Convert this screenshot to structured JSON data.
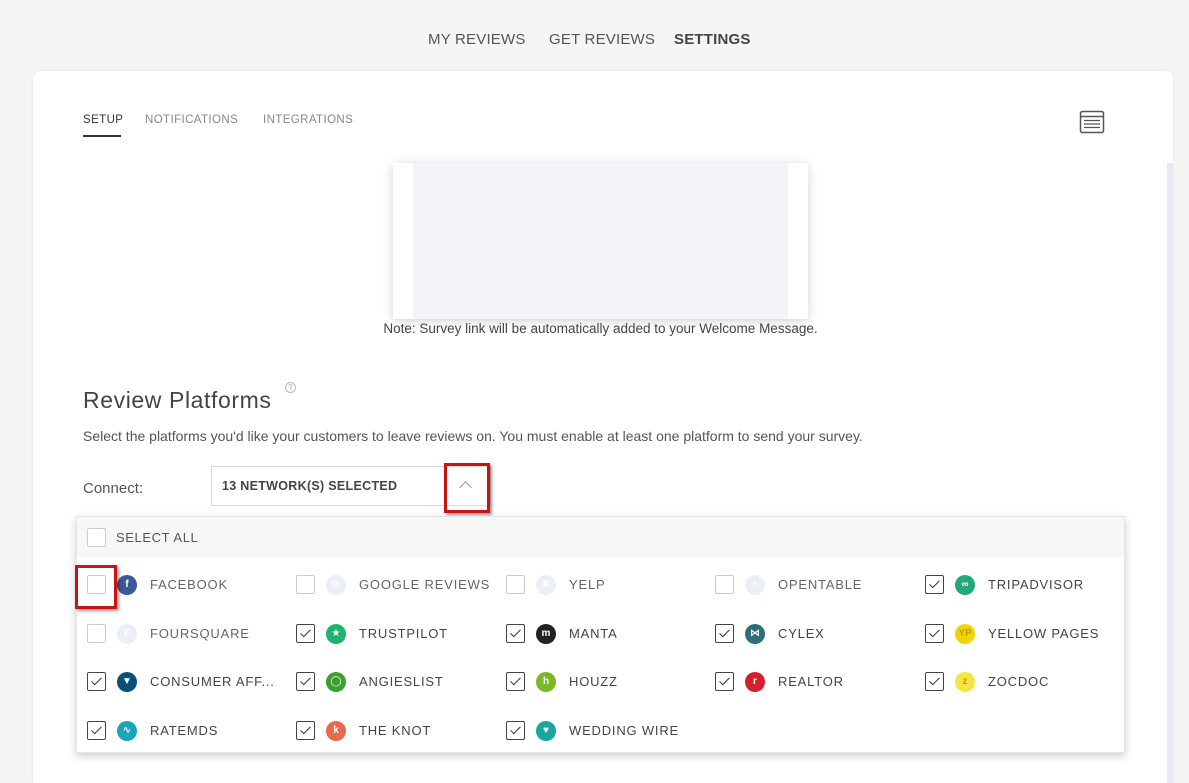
{
  "topnav": {
    "items": [
      {
        "label": "MY REVIEWS",
        "active": false
      },
      {
        "label": "GET REVIEWS",
        "active": false
      },
      {
        "label": "SETTINGS",
        "active": true
      }
    ]
  },
  "subtabs": [
    {
      "label": "SETUP",
      "active": true
    },
    {
      "label": "NOTIFICATIONS",
      "active": false
    },
    {
      "label": "INTEGRATIONS",
      "active": false
    }
  ],
  "preview": {
    "note": "Note: Survey link will be automatically added to your Welcome Message."
  },
  "review_platforms": {
    "title": "Review Platforms",
    "help": "?",
    "description": "Select the platforms you'd like your customers to leave reviews on. You must enable at least one platform to send your survey.",
    "connect_label": "Connect:",
    "selected_text": "13 NETWORK(S) SELECTED",
    "select_all_label": "SELECT ALL",
    "select_all_checked": false,
    "platforms": [
      {
        "label": "FACEBOOK",
        "checked": false,
        "icon": "facebook-icon",
        "glyph": "f",
        "color": "#3b5998"
      },
      {
        "label": "GOOGLE REVIEWS",
        "checked": false,
        "icon": "google-icon",
        "glyph": "G",
        "color": "#b8c4d6"
      },
      {
        "label": "YELP",
        "checked": false,
        "icon": "yelp-icon",
        "glyph": "✱",
        "color": "#b8c4d6"
      },
      {
        "label": "OPENTABLE",
        "checked": false,
        "icon": "opentable-icon",
        "glyph": "•",
        "color": "#b8c4d6"
      },
      {
        "label": "TRIPADVISOR",
        "checked": true,
        "icon": "tripadvisor-icon",
        "glyph": "∞",
        "color": "#22a87a"
      },
      {
        "label": "FOURSQUARE",
        "checked": false,
        "icon": "foursquare-icon",
        "glyph": "F",
        "color": "#b8c4d6"
      },
      {
        "label": "TRUSTPILOT",
        "checked": true,
        "icon": "trustpilot-icon",
        "glyph": "★",
        "color": "#1fb36b"
      },
      {
        "label": "MANTA",
        "checked": true,
        "icon": "manta-icon",
        "glyph": "m",
        "color": "#222222"
      },
      {
        "label": "CYLEX",
        "checked": true,
        "icon": "cylex-icon",
        "glyph": "⋈",
        "color": "#2d6e78"
      },
      {
        "label": "YELLOW PAGES",
        "checked": true,
        "icon": "yellowpages-icon",
        "glyph": "YP",
        "color": "#f0d400"
      },
      {
        "label": "CONSUMER AFF...",
        "checked": true,
        "icon": "consumeraffairs-icon",
        "glyph": "▼",
        "color": "#0b4f79"
      },
      {
        "label": "ANGIESLIST",
        "checked": true,
        "icon": "angieslist-icon",
        "glyph": "◯",
        "color": "#3aa02f"
      },
      {
        "label": "HOUZZ",
        "checked": true,
        "icon": "houzz-icon",
        "glyph": "h",
        "color": "#7ab829"
      },
      {
        "label": "REALTOR",
        "checked": true,
        "icon": "realtor-icon",
        "glyph": "r",
        "color": "#d3202f"
      },
      {
        "label": "ZOCDOC",
        "checked": true,
        "icon": "zocdoc-icon",
        "glyph": "z",
        "color": "#f4e542"
      },
      {
        "label": "RATEMDS",
        "checked": true,
        "icon": "ratemds-icon",
        "glyph": "∿",
        "color": "#1ca5b8"
      },
      {
        "label": "THE KNOT",
        "checked": true,
        "icon": "theknot-icon",
        "glyph": "k",
        "color": "#e86a4c"
      },
      {
        "label": "WEDDING WIRE",
        "checked": true,
        "icon": "weddingwire-icon",
        "glyph": "♥",
        "color": "#19a6a0"
      }
    ]
  }
}
